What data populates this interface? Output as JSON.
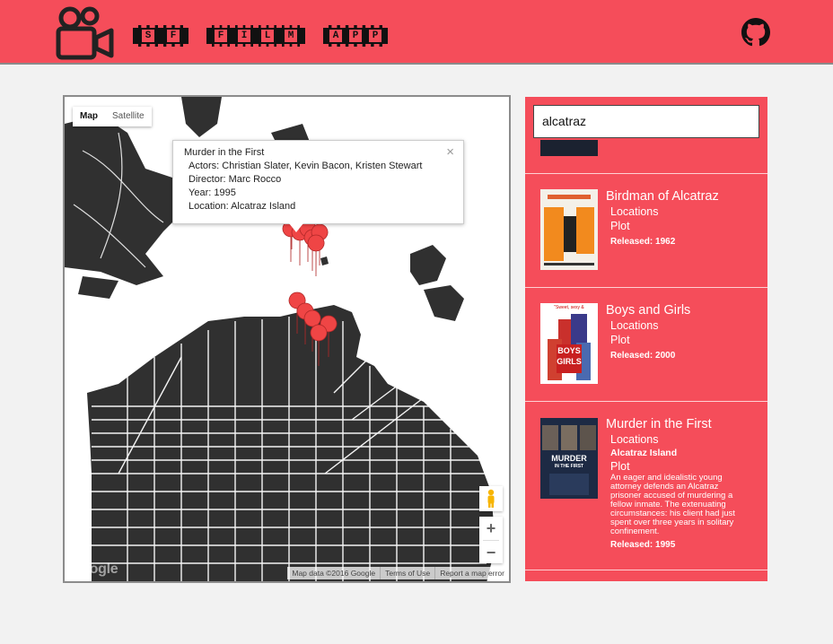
{
  "header": {
    "title_words": [
      "SF",
      "FILM",
      "APP"
    ],
    "logo_icon": "film-camera-icon",
    "github_icon": "github-icon",
    "brand_color": "#f54d5a"
  },
  "map": {
    "type_controls": [
      "Map",
      "Satellite"
    ],
    "active_type": "Map",
    "info_window": {
      "title": "Murder in the First",
      "actors": "Actors: Christian Slater, Kevin Bacon, Kristen Stewart",
      "director": "Director: Marc Rocco",
      "year": "Year: 1995",
      "location": "Location: Alcatraz Island",
      "close": "×"
    },
    "zoom_in": "+",
    "zoom_out": "−",
    "google_logo": "Google",
    "attribution": [
      "Map data ©2016 Google",
      "Terms of Use",
      "Report a map error"
    ]
  },
  "search": {
    "value": "alcatraz"
  },
  "results": [
    {
      "title": "Birdman of Alcatraz",
      "locations_label": "Locations",
      "plot_label": "Plot",
      "released": "Released: 1962"
    },
    {
      "title": "Boys and Girls",
      "locations_label": "Locations",
      "plot_label": "Plot",
      "released": "Released: 2000",
      "poster_text": [
        "\"Sweet, sexy &",
        "BOYS",
        "GIRLS"
      ]
    },
    {
      "title": "Murder in the First",
      "locations_label": "Locations",
      "location": "Alcatraz Island",
      "plot_label": "Plot",
      "plot": "An eager and idealistic young attorney defends an Alcatraz prisoner accused of murdering a fellow inmate. The extenuating circumstances: his client had just spent over three years in solitary confinement.",
      "released": "Released: 1995",
      "poster_text": [
        "MURDER",
        "IN THE FIRST"
      ]
    }
  ]
}
